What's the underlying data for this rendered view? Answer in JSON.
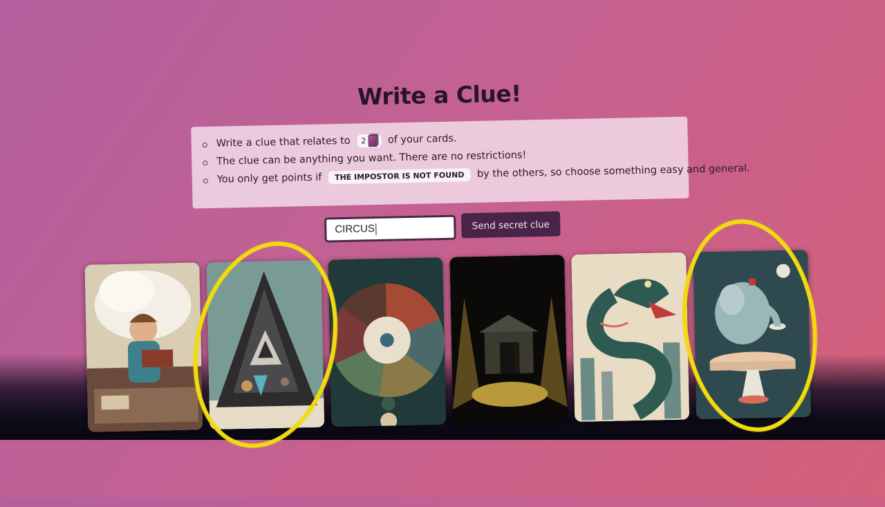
{
  "title": "Write a Clue!",
  "rules": {
    "line1_before": "Write a clue that relates to",
    "line1_count": "2",
    "line1_after": "of your cards.",
    "line2": "The clue can be anything you want. There are no restrictions!",
    "line3_before": "You only get points if",
    "line3_pill": "THE IMPOSTOR IS NOT FOUND",
    "line3_after": "by the others, so choose something easy and general."
  },
  "clue_input": {
    "value": "CIRCUS"
  },
  "send_button": {
    "label": "Send secret clue"
  },
  "cards": [
    {
      "name": "boy-reading-dreams-card",
      "selected": false
    },
    {
      "name": "pyramid-objects-card",
      "selected": true
    },
    {
      "name": "wheel-of-fortune-card",
      "selected": false
    },
    {
      "name": "shed-in-cornfield-card",
      "selected": false
    },
    {
      "name": "city-serpent-card",
      "selected": false
    },
    {
      "name": "elephant-on-pedestal-card",
      "selected": true
    }
  ],
  "colors": {
    "selection_ring": "#f0da10",
    "button_bg": "#4a2446",
    "background_start": "#b3609e",
    "background_end": "#d4607a"
  }
}
